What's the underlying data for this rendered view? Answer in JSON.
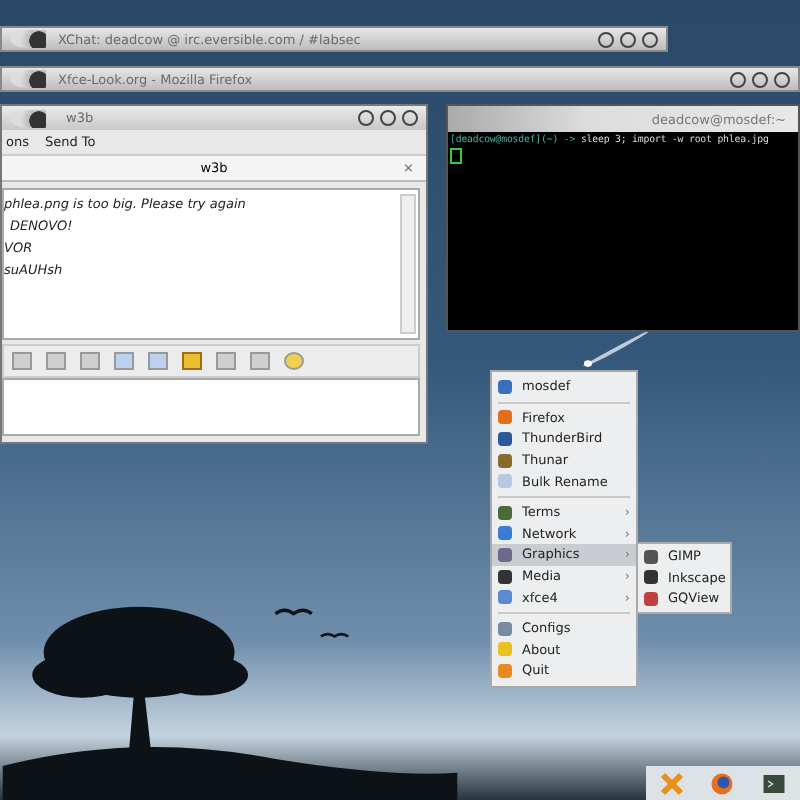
{
  "xchat_window": {
    "title": "XChat: deadcow @ irc.eversible.com / #labsec"
  },
  "firefox_window": {
    "title": "Xfce-Look.org - Mozilla Firefox"
  },
  "chat_window": {
    "title": "w3b",
    "menu": [
      "ons",
      "Send To"
    ],
    "tab": "w3b",
    "close": "×",
    "lines": [
      {
        "text": "phlea.png is too big. Please try again",
        "indented": false
      },
      {
        "text": "DENOVO!",
        "indented": true
      },
      {
        "text": "VOR",
        "indented": false
      },
      {
        "text": "suAUHsh",
        "indented": false
      }
    ]
  },
  "terminal": {
    "title": "deadcow@mosdef:~",
    "prompt": "[deadcow@mosdef](~) ->",
    "command": "sleep 3; import -w root phlea.jpg"
  },
  "menu": {
    "groups": [
      [
        {
          "label": "mosdef",
          "submenu": false,
          "selected": false
        }
      ],
      [
        {
          "label": "Firefox",
          "submenu": false,
          "selected": false
        },
        {
          "label": "ThunderBird",
          "submenu": false,
          "selected": false
        },
        {
          "label": "Thunar",
          "submenu": false,
          "selected": false
        },
        {
          "label": "Bulk Rename",
          "submenu": false,
          "selected": false
        }
      ],
      [
        {
          "label": "Terms",
          "submenu": true,
          "selected": false
        },
        {
          "label": "Network",
          "submenu": true,
          "selected": false
        },
        {
          "label": "Graphics",
          "submenu": true,
          "selected": true
        },
        {
          "label": "Media",
          "submenu": true,
          "selected": false
        },
        {
          "label": "xfce4",
          "submenu": true,
          "selected": false
        }
      ],
      [
        {
          "label": "Configs",
          "submenu": false,
          "selected": false
        },
        {
          "label": "About",
          "submenu": false,
          "selected": false
        },
        {
          "label": "Quit",
          "submenu": false,
          "selected": false
        }
      ]
    ],
    "arrow": "›",
    "submenu": [
      "GIMP",
      "Inkscape",
      "GQView"
    ]
  }
}
